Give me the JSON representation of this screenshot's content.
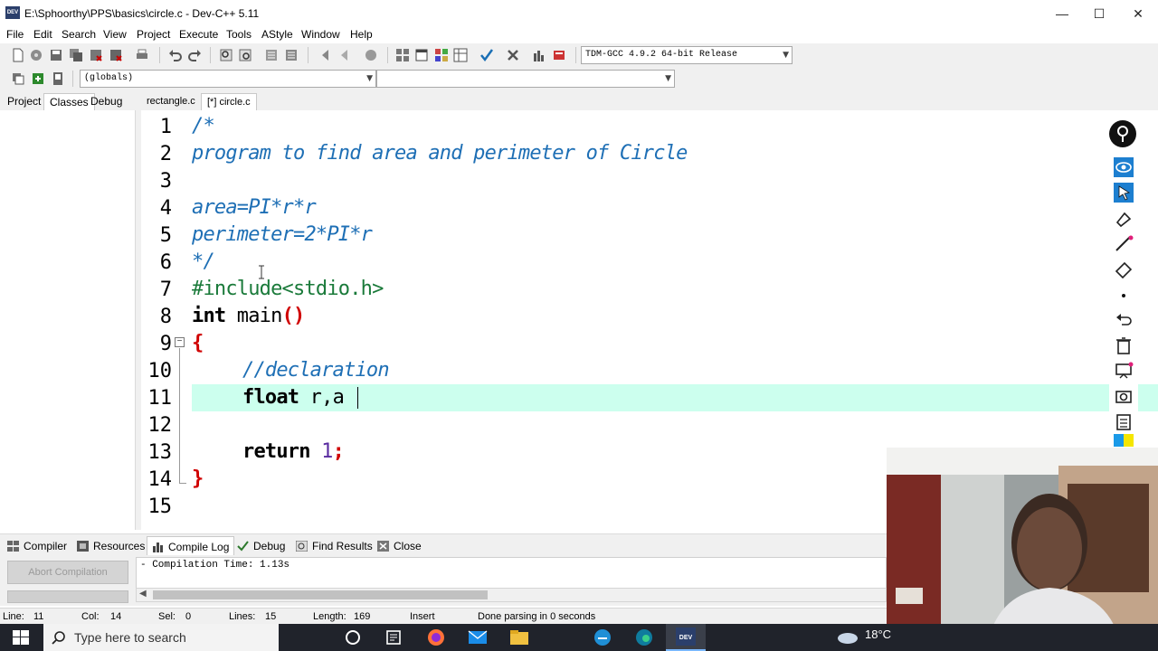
{
  "window": {
    "app_icon_text": "DEV",
    "title": "E:\\Sphoorthy\\PPS\\basics\\circle.c - Dev-C++ 5.11",
    "minimize_glyph": "—",
    "maximize_glyph": "☐",
    "close_glyph": "✕"
  },
  "menu": {
    "file": "File",
    "edit": "Edit",
    "search": "Search",
    "view": "View",
    "project": "Project",
    "execute": "Execute",
    "tools": "Tools",
    "astyle": "AStyle",
    "window": "Window",
    "help": "Help"
  },
  "toolbar": {
    "compiler_select": "TDM-GCC 4.9.2 64-bit Release",
    "scope_select": "(globals)",
    "member_select": "",
    "dropdown_arrow": "▼"
  },
  "left_tabs": {
    "project": "Project",
    "classes": "Classes",
    "debug": "Debug"
  },
  "editor_tabs": {
    "rectangle": "rectangle.c",
    "circle": "[*] circle.c"
  },
  "editor": {
    "line_numbers": [
      "1",
      "2",
      "3",
      "4",
      "5",
      "6",
      "7",
      "8",
      "9",
      "10",
      "11",
      "12",
      "13",
      "14",
      "15"
    ],
    "lines": {
      "l1": "/*",
      "l2": "program to find area and perimeter of Circle",
      "l4": "area=PI*r*r",
      "l5": "perimeter=2*PI*r",
      "l6": "*/",
      "l7": "#include<stdio.h>",
      "l8_kw": "int",
      "l8_rest": " main",
      "l8_paren": "()",
      "l9": "{",
      "l10": "//declaration",
      "l11_kw": "float",
      "l11_rest": " r,a",
      "l13_kw": "return",
      "l13_num": "1",
      "l13_semi": ";",
      "l14": "}"
    },
    "fold_glyph": "−"
  },
  "bottom_tabs": {
    "compiler": "Compiler",
    "resources": "Resources",
    "compile_log": "Compile Log",
    "debug": "Debug",
    "find_results": "Find Results",
    "close": "Close"
  },
  "compile_log": {
    "abort_label": "Abort Compilation",
    "text": "- Compilation Time: 1.13s"
  },
  "status": {
    "line_label": "Line:",
    "line": "11",
    "col_label": "Col:",
    "col": "14",
    "sel_label": "Sel:",
    "sel": "0",
    "lines_label": "Lines:",
    "lines": "15",
    "length_label": "Length:",
    "length": "169",
    "mode": "Insert",
    "message": "Done parsing in 0 seconds"
  },
  "taskbar": {
    "search_placeholder": "Type here to search",
    "weather": "18°C"
  },
  "colors": {
    "comment": "#1e6fb5",
    "preprocessor": "#1a7a3a",
    "brace": "#d00000",
    "number": "#5a2ca0",
    "current_line": "#ccffee",
    "taskbar": "#20232b"
  }
}
